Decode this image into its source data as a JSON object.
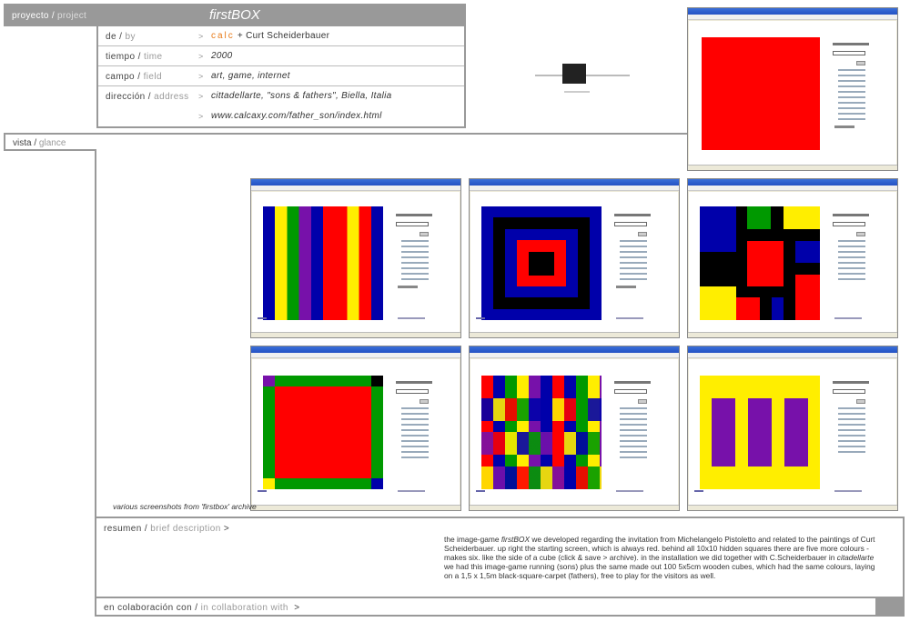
{
  "header": {
    "proyecto_label": "proyecto",
    "proyecto_en": "project",
    "title": "firstBOX"
  },
  "info": {
    "rows": [
      {
        "label": "de",
        "en": "by",
        "arrow": ">",
        "value_accent": "calc",
        "value": "+ Curt Scheiderbauer"
      },
      {
        "label": "tiempo",
        "en": "time",
        "arrow": ">",
        "value": "2000"
      },
      {
        "label": "campo",
        "en": "field",
        "arrow": ">",
        "value": "art, game, internet"
      },
      {
        "label": "dirección",
        "en": "address",
        "arrow": ">",
        "value": "cittadellarte, \"sons & fathers\", Biella, Italia",
        "value2": "www.calcaxy.com/father_son/index.html"
      }
    ]
  },
  "vista": {
    "label": "vista",
    "en": "glance"
  },
  "caption": "various screenshots from 'firstbox' archive",
  "resumen": {
    "label": "resumen",
    "en": "brief description",
    "arrow": ">",
    "text_pre": "the image-game ",
    "text_em": "firstBOX",
    "text_mid": " we developed regarding the invitation from Michelangelo Pistoletto and related to the paintings of Curt Scheiderbauer. up right the starting screen, which is always red. behind all 10x10 hidden squares there are five more colours - makes six. like the side of a cube (click & save > archive). in the installation we did together with C.Scheiderbauer in ",
    "text_em2": "citadellarte",
    "text_post": " we had this image-game running (sons) plus the same made out 100 5x5cm wooden cubes, which had the same colours, laying on a 1,5 x 1,5m black-square-carpet (fathers), free to play for the visitors as well."
  },
  "collab": {
    "label": "en colaboración con",
    "en": "in collaboration with",
    "arrow": ">"
  },
  "colors": {
    "red": "#ff0000",
    "blue": "#0000aa",
    "yellow": "#ffee00",
    "green": "#009900",
    "purple": "#7711aa",
    "black": "#000000",
    "gray": "#999999",
    "accent": "#e87b1a"
  }
}
